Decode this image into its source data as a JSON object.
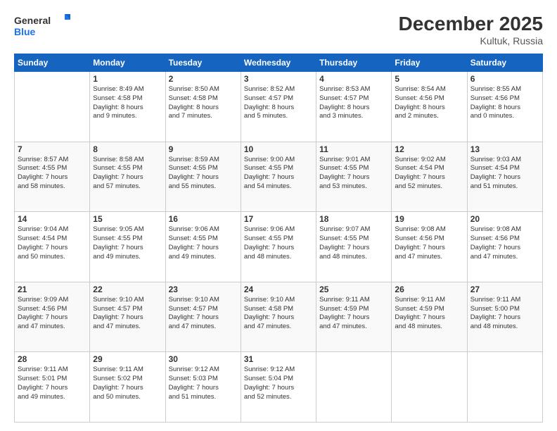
{
  "logo": {
    "line1": "General",
    "line2": "Blue"
  },
  "title": "December 2025",
  "location": "Kultuk, Russia",
  "weekdays": [
    "Sunday",
    "Monday",
    "Tuesday",
    "Wednesday",
    "Thursday",
    "Friday",
    "Saturday"
  ],
  "weeks": [
    [
      {
        "day": "",
        "info": ""
      },
      {
        "day": "1",
        "info": "Sunrise: 8:49 AM\nSunset: 4:58 PM\nDaylight: 8 hours\nand 9 minutes."
      },
      {
        "day": "2",
        "info": "Sunrise: 8:50 AM\nSunset: 4:58 PM\nDaylight: 8 hours\nand 7 minutes."
      },
      {
        "day": "3",
        "info": "Sunrise: 8:52 AM\nSunset: 4:57 PM\nDaylight: 8 hours\nand 5 minutes."
      },
      {
        "day": "4",
        "info": "Sunrise: 8:53 AM\nSunset: 4:57 PM\nDaylight: 8 hours\nand 3 minutes."
      },
      {
        "day": "5",
        "info": "Sunrise: 8:54 AM\nSunset: 4:56 PM\nDaylight: 8 hours\nand 2 minutes."
      },
      {
        "day": "6",
        "info": "Sunrise: 8:55 AM\nSunset: 4:56 PM\nDaylight: 8 hours\nand 0 minutes."
      }
    ],
    [
      {
        "day": "7",
        "info": "Sunrise: 8:57 AM\nSunset: 4:55 PM\nDaylight: 7 hours\nand 58 minutes."
      },
      {
        "day": "8",
        "info": "Sunrise: 8:58 AM\nSunset: 4:55 PM\nDaylight: 7 hours\nand 57 minutes."
      },
      {
        "day": "9",
        "info": "Sunrise: 8:59 AM\nSunset: 4:55 PM\nDaylight: 7 hours\nand 55 minutes."
      },
      {
        "day": "10",
        "info": "Sunrise: 9:00 AM\nSunset: 4:55 PM\nDaylight: 7 hours\nand 54 minutes."
      },
      {
        "day": "11",
        "info": "Sunrise: 9:01 AM\nSunset: 4:55 PM\nDaylight: 7 hours\nand 53 minutes."
      },
      {
        "day": "12",
        "info": "Sunrise: 9:02 AM\nSunset: 4:54 PM\nDaylight: 7 hours\nand 52 minutes."
      },
      {
        "day": "13",
        "info": "Sunrise: 9:03 AM\nSunset: 4:54 PM\nDaylight: 7 hours\nand 51 minutes."
      }
    ],
    [
      {
        "day": "14",
        "info": "Sunrise: 9:04 AM\nSunset: 4:54 PM\nDaylight: 7 hours\nand 50 minutes."
      },
      {
        "day": "15",
        "info": "Sunrise: 9:05 AM\nSunset: 4:55 PM\nDaylight: 7 hours\nand 49 minutes."
      },
      {
        "day": "16",
        "info": "Sunrise: 9:06 AM\nSunset: 4:55 PM\nDaylight: 7 hours\nand 49 minutes."
      },
      {
        "day": "17",
        "info": "Sunrise: 9:06 AM\nSunset: 4:55 PM\nDaylight: 7 hours\nand 48 minutes."
      },
      {
        "day": "18",
        "info": "Sunrise: 9:07 AM\nSunset: 4:55 PM\nDaylight: 7 hours\nand 48 minutes."
      },
      {
        "day": "19",
        "info": "Sunrise: 9:08 AM\nSunset: 4:56 PM\nDaylight: 7 hours\nand 47 minutes."
      },
      {
        "day": "20",
        "info": "Sunrise: 9:08 AM\nSunset: 4:56 PM\nDaylight: 7 hours\nand 47 minutes."
      }
    ],
    [
      {
        "day": "21",
        "info": "Sunrise: 9:09 AM\nSunset: 4:56 PM\nDaylight: 7 hours\nand 47 minutes."
      },
      {
        "day": "22",
        "info": "Sunrise: 9:10 AM\nSunset: 4:57 PM\nDaylight: 7 hours\nand 47 minutes."
      },
      {
        "day": "23",
        "info": "Sunrise: 9:10 AM\nSunset: 4:57 PM\nDaylight: 7 hours\nand 47 minutes."
      },
      {
        "day": "24",
        "info": "Sunrise: 9:10 AM\nSunset: 4:58 PM\nDaylight: 7 hours\nand 47 minutes."
      },
      {
        "day": "25",
        "info": "Sunrise: 9:11 AM\nSunset: 4:59 PM\nDaylight: 7 hours\nand 47 minutes."
      },
      {
        "day": "26",
        "info": "Sunrise: 9:11 AM\nSunset: 4:59 PM\nDaylight: 7 hours\nand 48 minutes."
      },
      {
        "day": "27",
        "info": "Sunrise: 9:11 AM\nSunset: 5:00 PM\nDaylight: 7 hours\nand 48 minutes."
      }
    ],
    [
      {
        "day": "28",
        "info": "Sunrise: 9:11 AM\nSunset: 5:01 PM\nDaylight: 7 hours\nand 49 minutes."
      },
      {
        "day": "29",
        "info": "Sunrise: 9:11 AM\nSunset: 5:02 PM\nDaylight: 7 hours\nand 50 minutes."
      },
      {
        "day": "30",
        "info": "Sunrise: 9:12 AM\nSunset: 5:03 PM\nDaylight: 7 hours\nand 51 minutes."
      },
      {
        "day": "31",
        "info": "Sunrise: 9:12 AM\nSunset: 5:04 PM\nDaylight: 7 hours\nand 52 minutes."
      },
      {
        "day": "",
        "info": ""
      },
      {
        "day": "",
        "info": ""
      },
      {
        "day": "",
        "info": ""
      }
    ]
  ]
}
